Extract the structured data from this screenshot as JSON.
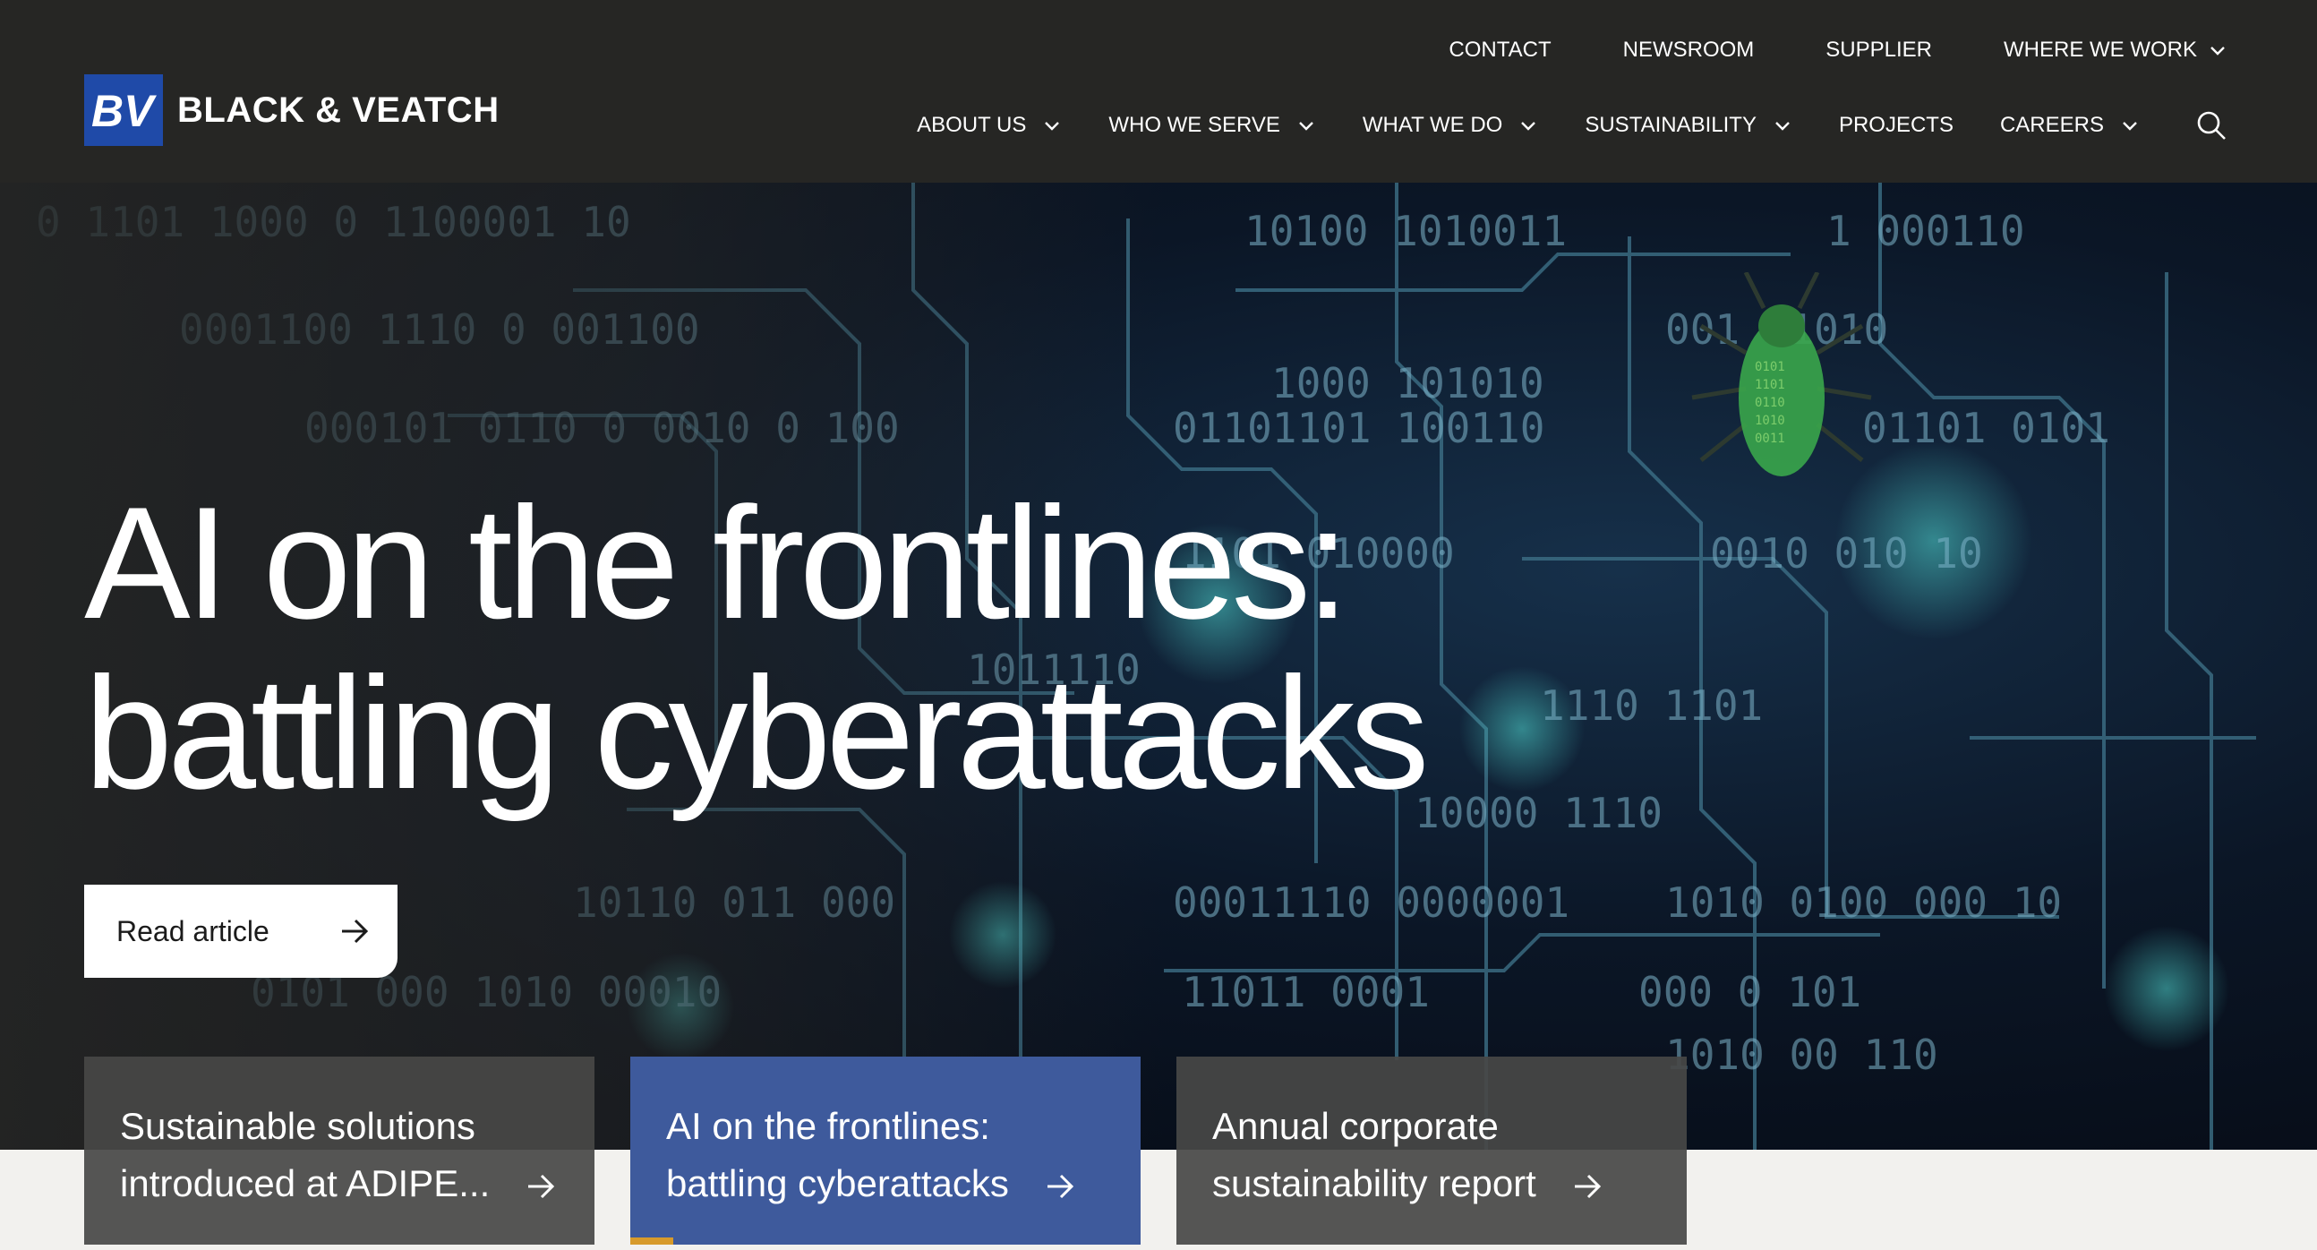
{
  "brand": {
    "name": "BLACK & VEATCH",
    "mark_color": "#1f4aa8"
  },
  "utility_nav": {
    "items": [
      {
        "label": "CONTACT"
      },
      {
        "label": "NEWSROOM"
      },
      {
        "label": "SUPPLIER"
      },
      {
        "label": "WHERE WE WORK",
        "icon": "chevron-down-icon"
      }
    ]
  },
  "main_nav": {
    "items": [
      {
        "label": "ABOUT US",
        "icon": "chevron-down-icon"
      },
      {
        "label": "WHO WE SERVE",
        "icon": "chevron-down-icon"
      },
      {
        "label": "WHAT WE DO",
        "icon": "chevron-down-icon"
      },
      {
        "label": "SUSTAINABILITY",
        "icon": "chevron-down-icon"
      },
      {
        "label": "PROJECTS"
      },
      {
        "label": "CAREERS",
        "icon": "chevron-down-icon"
      }
    ],
    "search_icon": "search-icon"
  },
  "hero": {
    "title": "AI on the frontlines: battling cyberattacks",
    "cta_label": "Read article",
    "cta_icon": "arrow-right-icon"
  },
  "cards": [
    {
      "text": "Sustainable solutions introduced at ADIPE...",
      "active": false
    },
    {
      "text": "AI on the frontlines: battling cyberattacks",
      "active": true
    },
    {
      "text": "Annual corporate sustainability report",
      "active": false
    }
  ],
  "colors": {
    "header_bg": "#262624",
    "active_card": "#3e5a9c",
    "inactive_card": "#484846",
    "accent": "#d79a2b"
  }
}
